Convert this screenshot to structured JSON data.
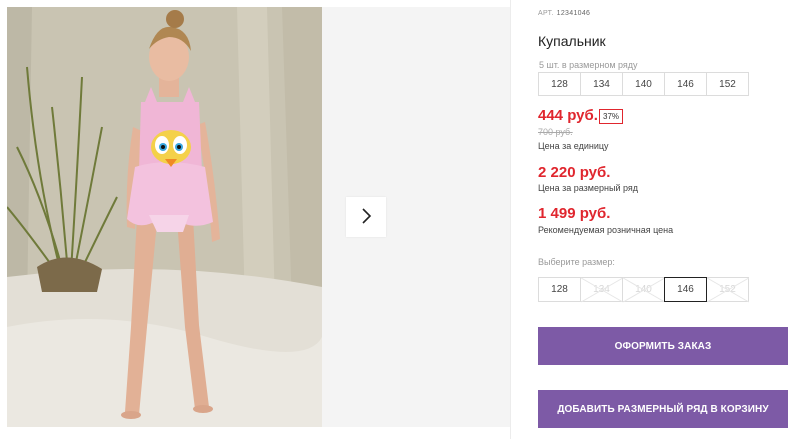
{
  "product": {
    "sku_label": "АРТ.",
    "sku": "12341046",
    "title": "Купальник",
    "image_alt": "girl-in-pink-swimsuit-photo"
  },
  "pack": {
    "note": "5 шт. в размерном ряду",
    "sizes": [
      "128",
      "134",
      "140",
      "146",
      "152"
    ]
  },
  "pricing": {
    "unit_price": "444 руб.",
    "discount": "37%",
    "old_price": "700 руб.",
    "unit_caption": "Цена за единицу",
    "pack_price": "2 220 руб.",
    "pack_caption": "Цена за размерный ряд",
    "retail_price": "1 499 руб.",
    "retail_caption": "Рекомендуемая розничная цена",
    "accent_color": "#e0262e"
  },
  "size_select": {
    "label": "Выберите размер:",
    "options": [
      {
        "label": "128",
        "state": "available"
      },
      {
        "label": "134",
        "state": "unavailable"
      },
      {
        "label": "140",
        "state": "unavailable"
      },
      {
        "label": "146",
        "state": "selected"
      },
      {
        "label": "152",
        "state": "unavailable"
      }
    ]
  },
  "actions": {
    "order_label": "ОФОРМИТЬ ЗАКАЗ",
    "add_pack_label": "ДОБАВИТЬ РАЗМЕРНЫЙ РЯД В КОРЗИНУ",
    "button_color": "#7d5aa6"
  },
  "gallery": {
    "next_icon": "chevron-right-icon"
  }
}
